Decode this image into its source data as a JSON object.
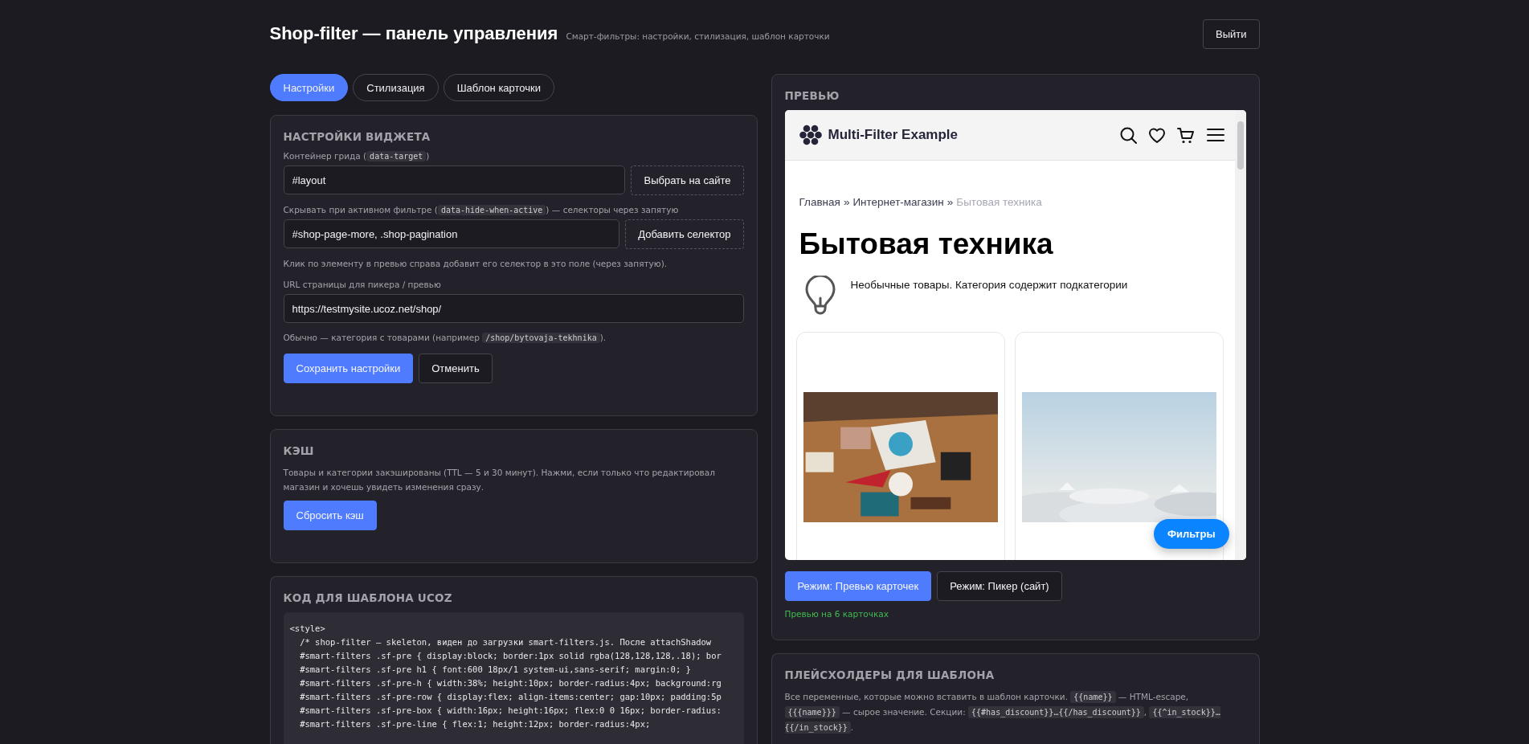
{
  "header": {
    "title": "Shop-filter — панель управления",
    "subtitle": "Смарт-фильтры: настройки, стилизация, шаблон карточки",
    "logout": "Выйти"
  },
  "tabs": [
    {
      "label": "Настройки",
      "selected": true
    },
    {
      "label": "Стилизация",
      "selected": false
    },
    {
      "label": "Шаблон карточки",
      "selected": false
    }
  ],
  "widget_settings": {
    "heading": "НАСТРОЙКИ ВИДЖЕТА",
    "fields": [
      {
        "label": [
          {
            "kind": "text",
            "text": "Контейнер грида ("
          },
          {
            "kind": "code",
            "text": "data-target"
          },
          {
            "kind": "text",
            "text": ")"
          }
        ],
        "value": "#layout",
        "button": "Выбрать на сайте"
      },
      {
        "label": [
          {
            "kind": "text",
            "text": "Скрывать при активном фильтре ("
          },
          {
            "kind": "code",
            "text": "data-hide-when-active"
          },
          {
            "kind": "text",
            "text": ") — селекторы через запятую"
          }
        ],
        "value": "#shop-page-more, .shop-pagination",
        "button": "Добавить селектор",
        "hint": [
          {
            "kind": "text",
            "text": "Клик по элементу в превью справа добавит его селектор в это поле (через запятую)."
          }
        ]
      },
      {
        "label": [
          {
            "kind": "text",
            "text": "URL страницы для пикера / превью"
          }
        ],
        "value": "https://testmysite.ucoz.net/shop/",
        "hint": [
          {
            "kind": "text",
            "text": "Обычно — категория с товарами (например "
          },
          {
            "kind": "code",
            "text": "/shop/bytovaja-tekhnika"
          },
          {
            "kind": "text",
            "text": ")."
          }
        ]
      }
    ],
    "buttons": [
      {
        "label": "Сохранить настройки",
        "kind": "primary"
      },
      {
        "label": "Отменить",
        "kind": "secondary"
      }
    ]
  },
  "cache": {
    "heading": "КЭШ",
    "text": "Товары и категории закэшированы (TTL — 5 и 30 минут). Нажми, если только что редактировал магазин и хочешь увидеть изменения сразу.",
    "button": "Сбросить кэш"
  },
  "template_code": {
    "heading": "КОД ДЛЯ ШАБЛОНА UCOZ",
    "lines": [
      "<style>",
      "  /* shop-filter — skeleton, виден до загрузки smart-filters.js. После attachShadow",
      "  #smart-filters .sf-pre { display:block; border:1px solid rgba(128,128,128,.18); bor",
      "  #smart-filters .sf-pre h1 { font:600 18px/1 system-ui,sans-serif; margin:0; }",
      "  #smart-filters .sf-pre-h { width:38%; height:10px; border-radius:4px; background:rg",
      "  #smart-filters .sf-pre-row { display:flex; align-items:center; gap:10px; padding:5p",
      "  #smart-filters .sf-pre-box { width:16px; height:16px; flex:0 0 16px; border-radius:",
      "  #smart-filters .sf-pre-line { flex:1; height:12px; border-radius:4px;"
    ]
  },
  "preview": {
    "heading": "ПРЕВЬЮ",
    "site": {
      "brand": "Multi-Filter Example",
      "breadcrumb": [
        {
          "label": "Главная",
          "current": false
        },
        {
          "label": "Интернет-магазин",
          "current": false
        },
        {
          "label": "Бытовая техника",
          "current": true
        }
      ],
      "separator": "»",
      "title": "Бытовая техника",
      "description": "Необычные товары. Категория содержит подкатегории",
      "filters_button": "Фильтры"
    },
    "modes": [
      {
        "label": "Режим: Превью карточек",
        "selected": true
      },
      {
        "label": "Режим: Пикер (сайт)",
        "selected": false
      }
    ],
    "status": "Превью на 6 карточках"
  },
  "placeholders": {
    "heading": "ПЛЕЙСХОЛДЕРЫ ДЛЯ ШАБЛОНА",
    "text": [
      {
        "kind": "text",
        "text": "Все переменные, которые можно вставить в шаблон карточки. "
      },
      {
        "kind": "code",
        "text": "{{name}}"
      },
      {
        "kind": "text",
        "text": " — HTML-escape, "
      },
      {
        "kind": "code",
        "text": "{{{name}}}"
      },
      {
        "kind": "text",
        "text": " — сырое значение. Секции: "
      },
      {
        "kind": "code",
        "text": "{{#has_discount}}…{{/has_discount}}"
      },
      {
        "kind": "text",
        "text": ", "
      },
      {
        "kind": "code",
        "text": "{{^in_stock}}…{{/in_stock}}"
      },
      {
        "kind": "text",
        "text": "."
      }
    ]
  }
}
